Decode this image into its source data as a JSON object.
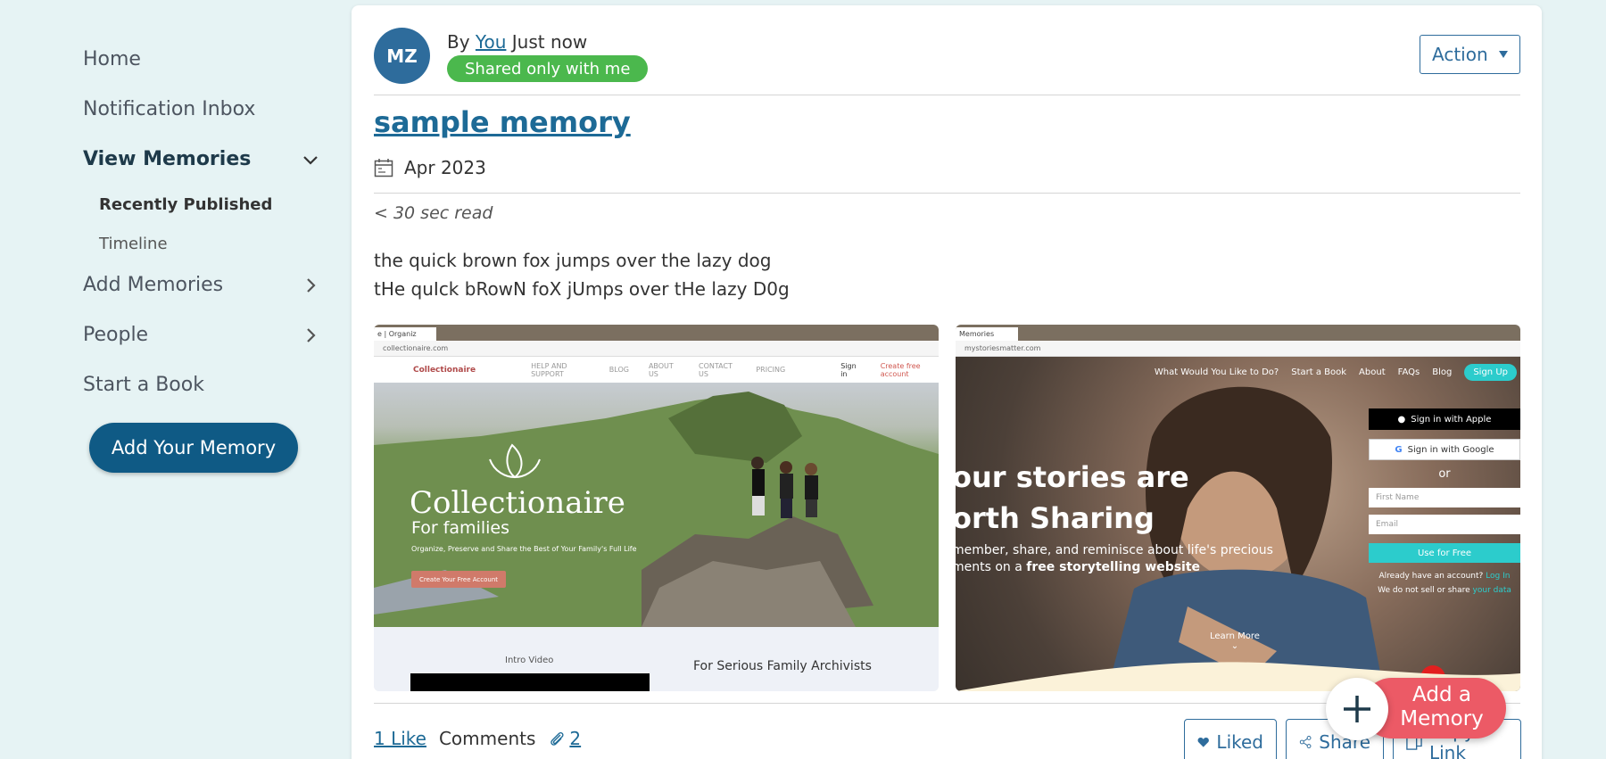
{
  "sidebar": {
    "items": [
      {
        "label": "Home"
      },
      {
        "label": "Notification Inbox"
      },
      {
        "label": "View Memories"
      },
      {
        "label": "Add Memories"
      },
      {
        "label": "People"
      },
      {
        "label": "Start a Book"
      }
    ],
    "sub_items": [
      {
        "label": "Recently Published"
      },
      {
        "label": "Timeline"
      }
    ],
    "add_button": "Add Your Memory"
  },
  "post": {
    "avatar_initials": "MZ",
    "by_prefix": "By",
    "author": "You",
    "time": "Just now",
    "badge": "Shared only with me",
    "action_label": "Action",
    "title": "sample memory",
    "date": "Apr 2023",
    "read_time": "< 30 sec read",
    "body_lines": [
      "the quick brown fox jumps over the lazy dog",
      "tHe quIck bRowN foX jUmps over tHe lazy D0g"
    ]
  },
  "thumb1": {
    "tab": "e | Organiz",
    "url": "collectionaire.com",
    "brand": "Collectionaire",
    "nav": [
      "HELP AND SUPPORT",
      "BLOG",
      "ABOUT US",
      "CONTACT US",
      "PRICING"
    ],
    "sign_in": "Sign in",
    "create": "Create free account",
    "hero_title": "Collectionaire",
    "hero_sub": "For families",
    "tagline": "Organize, Preserve and Share the Best of Your Family's Full Life",
    "cta": "Create Your Free Account",
    "intro": "Intro Video",
    "archivists": "For Serious Family Archivists"
  },
  "thumb2": {
    "tab": "Memories",
    "url": "mystoriesmatter.com",
    "nav": [
      "What Would You Like to Do?",
      "Start a Book",
      "About",
      "FAQs",
      "Blog"
    ],
    "signup": "Sign Up",
    "headline1": "our stories are",
    "headline2": "orth Sharing",
    "copy1": "member, share, and reminisce about life's precious",
    "copy2_plain": "ments on a ",
    "copy2_bold": "free storytelling website",
    "apple": "Sign in with Apple",
    "google": "Sign in with Google",
    "or": "or",
    "first_name": "First Name",
    "email": "Email",
    "use_free": "Use for Free",
    "have_account": "Already have an account?",
    "log_in": "Log In",
    "no_sell": "We do not sell or share",
    "your_data": "your data",
    "learn_more": "Learn More"
  },
  "footer": {
    "likes": "1 Like",
    "comments": "Comments",
    "attachments": "2",
    "liked": "Liked",
    "share": "Share",
    "copy_link": "Copy Link"
  },
  "fab": {
    "line1": "Add a",
    "line2": "Memory"
  },
  "colors": {
    "primary": "#0f5a85",
    "link": "#1d6a96",
    "badge_green": "#4bb84d",
    "fab_red": "#ec5a66",
    "background": "#e6f3f4"
  }
}
